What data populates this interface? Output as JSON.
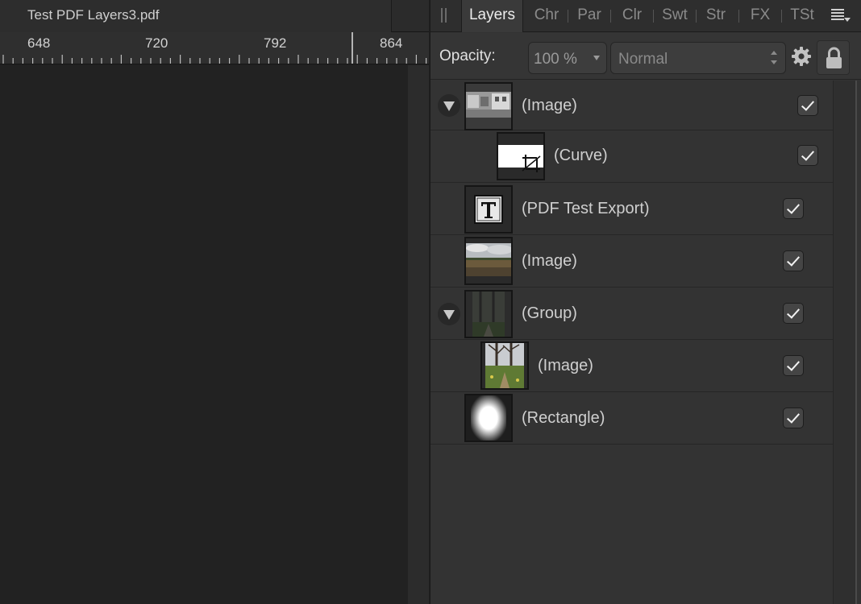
{
  "document": {
    "tab_title": "Test PDF Layers3.pdf",
    "ruler_labels": [
      "648",
      "720",
      "792",
      "864"
    ]
  },
  "panel": {
    "tabs": [
      "Layers",
      "Chr",
      "Par",
      "Clr",
      "Swt",
      "Str",
      "FX",
      "TSt"
    ],
    "active_tab": "Layers",
    "opacity_label": "Opacity:",
    "opacity_value": "100 %",
    "blend_mode": "Normal",
    "icons": [
      "panel-grip-icon",
      "panel-menu-icon",
      "gear-icon",
      "lock-icon",
      "expand-triangle-icon",
      "checkbox-checked-icon"
    ]
  },
  "layers": [
    {
      "name": "(Image)",
      "expanded": true,
      "level": 0,
      "visible": true,
      "thumb": "street-photo"
    },
    {
      "name": "(Curve)",
      "level": 1,
      "visible": true,
      "thumb": "crop-curve"
    },
    {
      "name": "(PDF Test Export)",
      "level": 0,
      "visible": true,
      "thumb": "text-frame"
    },
    {
      "name": "(Image)",
      "level": 0,
      "visible": true,
      "thumb": "field-photo"
    },
    {
      "name": "(Group)",
      "expanded": true,
      "level": 0,
      "visible": true,
      "thumb": "dark-trees"
    },
    {
      "name": "(Image)",
      "level": 1,
      "visible": true,
      "thumb": "tree-path"
    },
    {
      "name": "(Rectangle)",
      "level": 0,
      "visible": true,
      "thumb": "radial-rect"
    }
  ]
}
